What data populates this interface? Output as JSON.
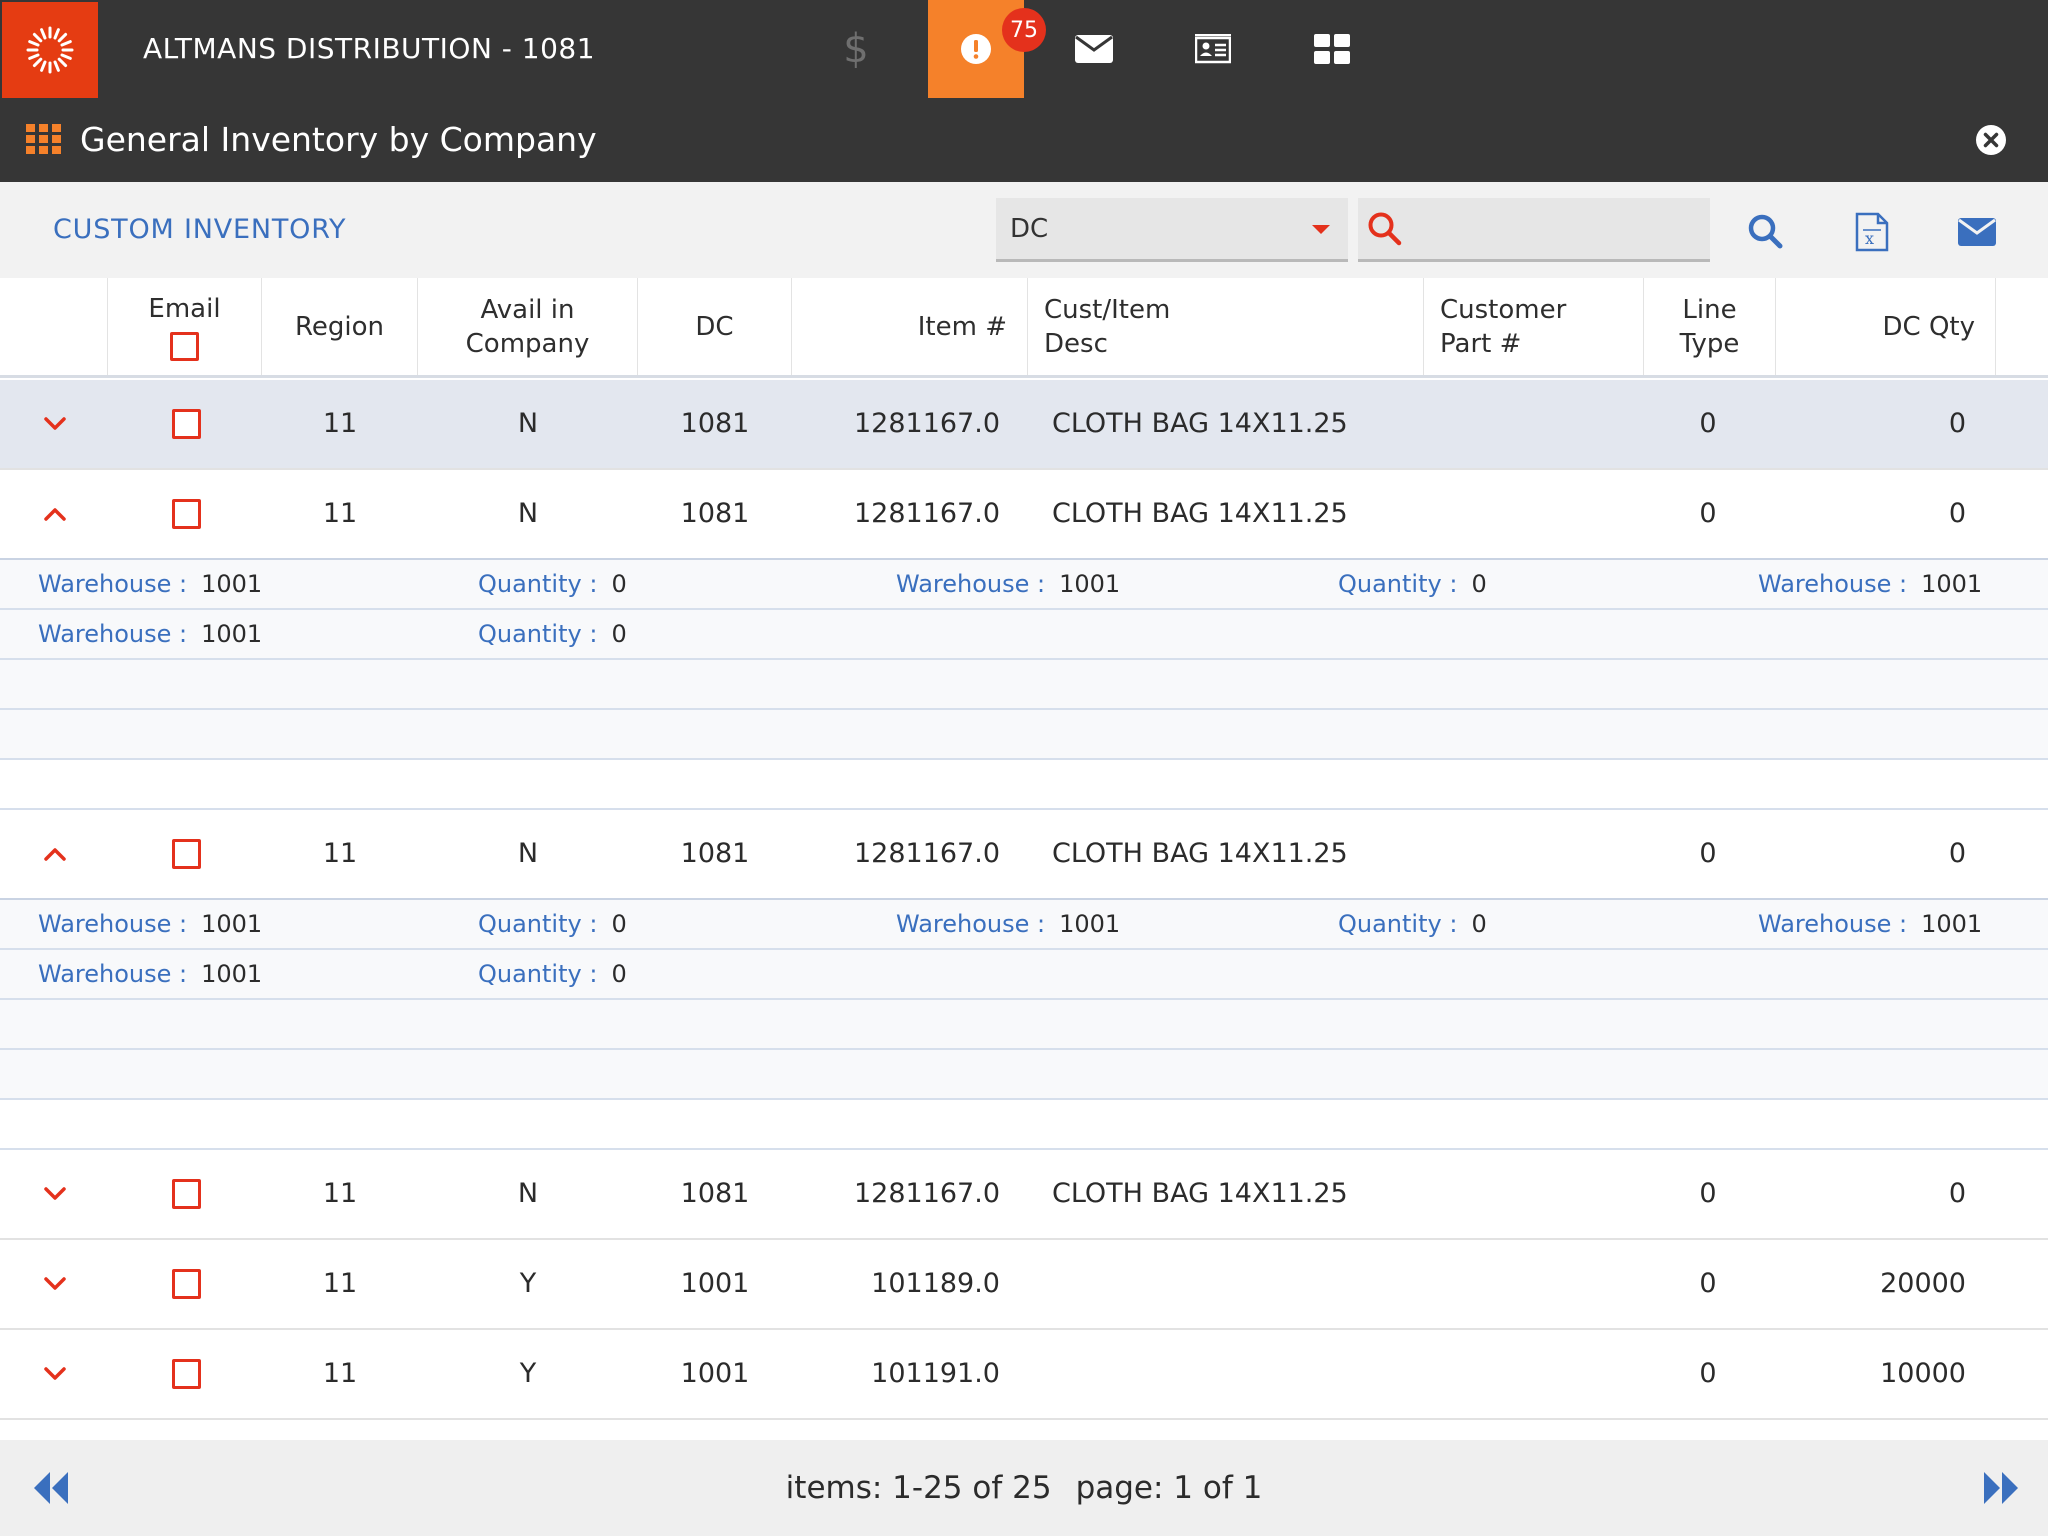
{
  "app": {
    "company": "ALTMANS DISTRIBUTION - 1081",
    "alert_count": "75",
    "dollar_symbol": "$"
  },
  "page": {
    "title": "General Inventory by Company"
  },
  "toolbar": {
    "section_title": "CUSTOM INVENTORY",
    "filter_value": "DC",
    "search_value": "",
    "search_placeholder": ""
  },
  "table": {
    "columns": {
      "email": "Email",
      "region": "Region",
      "avail_line1": "Avail in",
      "avail_line2": "Company",
      "dc": "DC",
      "item": "Item #",
      "desc_line1": "Cust/Item",
      "desc_line2": "Desc",
      "part_line1": "Customer",
      "part_line2": "Part #",
      "linetype_line1": "Line",
      "linetype_line2": "Type",
      "dcqty": "DC Qty"
    },
    "rows": [
      {
        "region": "11",
        "avail": "N",
        "dc": "1081",
        "item": "1281167.0",
        "desc": "CLOTH BAG 14X11.25",
        "line_type": "0",
        "dc_qty": "0",
        "expanded": false,
        "selected": true
      },
      {
        "region": "11",
        "avail": "N",
        "dc": "1081",
        "item": "1281167.0",
        "desc": "CLOTH BAG 14X11.25",
        "line_type": "0",
        "dc_qty": "0",
        "expanded": true,
        "selected": false
      },
      {
        "region": "11",
        "avail": "N",
        "dc": "1081",
        "item": "1281167.0",
        "desc": "CLOTH BAG 14X11.25",
        "line_type": "0",
        "dc_qty": "0",
        "expanded": true,
        "selected": false
      },
      {
        "region": "11",
        "avail": "N",
        "dc": "1081",
        "item": "1281167.0",
        "desc": "CLOTH BAG 14X11.25",
        "line_type": "0",
        "dc_qty": "0",
        "expanded": false,
        "selected": false
      },
      {
        "region": "11",
        "avail": "Y",
        "dc": "1001",
        "item": "101189.0",
        "desc": "",
        "line_type": "0",
        "dc_qty": "20000",
        "expanded": false,
        "selected": false
      },
      {
        "region": "11",
        "avail": "Y",
        "dc": "1001",
        "item": "101191.0",
        "desc": "",
        "line_type": "0",
        "dc_qty": "10000",
        "expanded": false,
        "selected": false
      }
    ],
    "detail_labels": {
      "warehouse": "Warehouse :",
      "quantity": "Quantity :"
    },
    "details": [
      {
        "line1": [
          {
            "warehouse": "1001",
            "quantity": "0"
          },
          {
            "warehouse": "1001",
            "quantity": "0"
          },
          {
            "warehouse": "1001"
          }
        ],
        "line2": [
          {
            "warehouse": "1001",
            "quantity": "0"
          }
        ]
      },
      {
        "line1": [
          {
            "warehouse": "1001",
            "quantity": "0"
          },
          {
            "warehouse": "1001",
            "quantity": "0"
          },
          {
            "warehouse": "1001"
          }
        ],
        "line2": [
          {
            "warehouse": "1001",
            "quantity": "0"
          }
        ]
      }
    ]
  },
  "footer": {
    "items_text": "items: 1-25 of 25",
    "page_text": "page: 1 of 1"
  },
  "colors": {
    "brand_red": "#e53c12",
    "alert_orange": "#f5812a",
    "badge_red": "#e4311c",
    "link_blue": "#3a6fbe",
    "topbar": "#363636"
  },
  "icons": {
    "logo": "sunburst-logo-icon",
    "dollar": "dollar-icon",
    "alert": "alert-icon",
    "mail": "mail-icon",
    "contacts": "contact-card-icon",
    "dashboard": "dashboard-grid-icon",
    "menu": "apps-grid-icon",
    "close": "close-circle-icon",
    "search": "search-icon",
    "excel": "excel-export-icon",
    "email": "email-icon",
    "expand": "chevron-down-icon",
    "collapse": "chevron-up-icon",
    "first_page": "double-chevron-left-icon",
    "last_page": "double-chevron-right-icon"
  }
}
